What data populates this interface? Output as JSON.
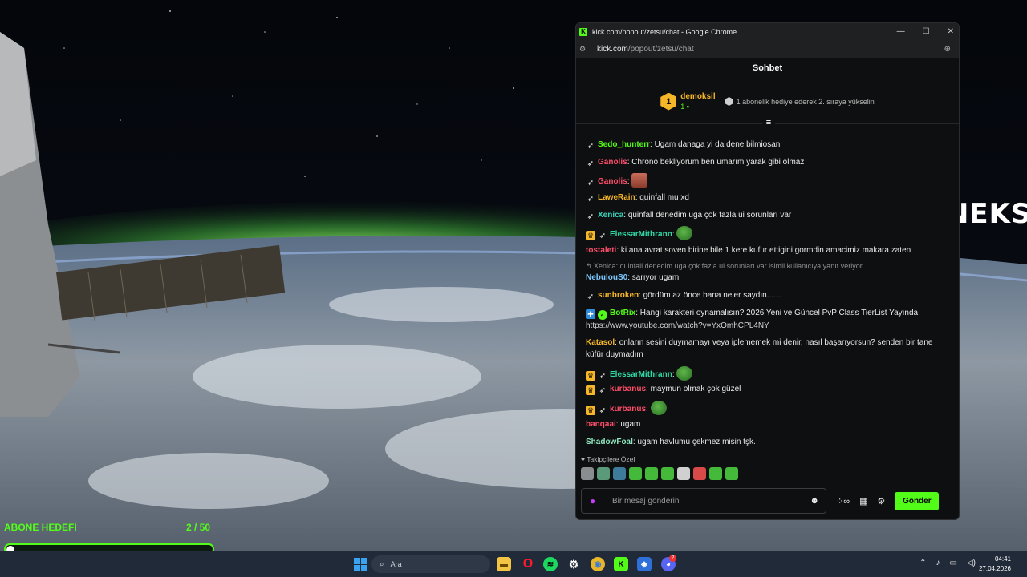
{
  "browser": {
    "window_title": "kick.com/popout/zetsu/chat - Google Chrome",
    "url_host": "kick.com",
    "url_path": "/popout/zetsu/chat"
  },
  "chat": {
    "header": "Sohbet",
    "leader": {
      "rank": "1",
      "name": "demoksil",
      "count": "1",
      "hint": "1 abonelik hediye ederek 2. sıraya yükselin"
    },
    "messages": [
      {
        "user": "Sedo_hunterr",
        "color": "#53fc18",
        "text": "Ugam danaga yi da dene bilmiosan",
        "badges": [
          "rocket-icon"
        ]
      },
      {
        "user": "Ganolis",
        "color": "#ff4d6a",
        "text": "Chrono bekliyorum ben umarım yarak gibi olmaz",
        "badges": [
          "rocket-icon"
        ]
      },
      {
        "user": "Ganolis",
        "color": "#ff4d6a",
        "text": "",
        "emote": "face",
        "badges": [
          "rocket-icon"
        ]
      },
      {
        "user": "LaweRain",
        "color": "#f5b729",
        "text": "quinfall mu xd",
        "badges": [
          "rocket-icon"
        ]
      },
      {
        "user": "Xenica",
        "color": "#3ad0b8",
        "text": "quinfall denedim uga çok fazla ui sorunları var",
        "badges": [
          "rocket-icon"
        ]
      },
      {
        "user": "ElessarMithrann",
        "color": "#2fd9a5",
        "text": "",
        "emote": "pepe",
        "badges": [
          "crown-icon",
          "rocket-icon"
        ]
      },
      {
        "user": "tostaleti",
        "color": "#ff4d6a",
        "text": "ki ana avrat soven birine bile 1 kere kufur ettigini gormdin amacimiz makara zaten",
        "badges": []
      },
      {
        "reply": "Xenica: quinfall denedim uga çok fazla ui sorunları var isimli kullanıcıya yanıt veriyor"
      },
      {
        "user": "NebulouS0",
        "color": "#7cc7ff",
        "text": "sarıyor ugam",
        "badges": []
      },
      {
        "user": "sunbroken",
        "color": "#f5b729",
        "text": "gördüm az önce bana neler saydın.......",
        "badges": [
          "rocket-icon"
        ]
      },
      {
        "user": "BotRix",
        "color": "#53fc18",
        "text": "Hangi karakteri oynamalısın? 2026 Yeni ve Güncel PvP Class TierList Yayında!",
        "link": "https://www.youtube.com/watch?v=YxOmhCPL4NY",
        "badges": [
          "bot-icon",
          "verified-icon"
        ]
      },
      {
        "user": "Katasol",
        "color": "#f5b729",
        "text": "onların sesini duymamayı veya iplememek mi denir, nasıl başarıyorsun? senden bir tane küfür duymadım",
        "badges": []
      },
      {
        "user": "ElessarMithrann",
        "color": "#2fd9a5",
        "text": "",
        "emote": "pepe",
        "badges": [
          "crown-icon",
          "rocket-icon"
        ]
      },
      {
        "user": "kurbanus",
        "color": "#ff4d6a",
        "text": "maymun olmak çok güzel",
        "badges": [
          "crown-icon",
          "rocket-icon"
        ]
      },
      {
        "user": "kurbanus",
        "color": "#ff4d6a",
        "text": "",
        "emote": "pepe",
        "badges": [
          "crown-icon",
          "rocket-icon"
        ]
      },
      {
        "user": "banqaai",
        "color": "#ff4d6a",
        "text": "ugam",
        "badges": []
      },
      {
        "user": "ShadowFoal",
        "color": "#8fe8c0",
        "text": "ugam havlumu çekmez misin tşk.",
        "badges": []
      }
    ],
    "emote_section_title": "Takipçilere Özel",
    "input_placeholder": "Bir mesaj gönderin",
    "send_label": "Gönder"
  },
  "overlay": {
    "logo_text": "OYUNEKS",
    "goal_title": "ABONE HEDEFİ",
    "goal_count": "2 / 50",
    "goal_progress": 0.04
  },
  "taskbar": {
    "search_placeholder": "Ara",
    "time": "04:41",
    "date": "27.04.2026",
    "discord_badge": "2"
  }
}
